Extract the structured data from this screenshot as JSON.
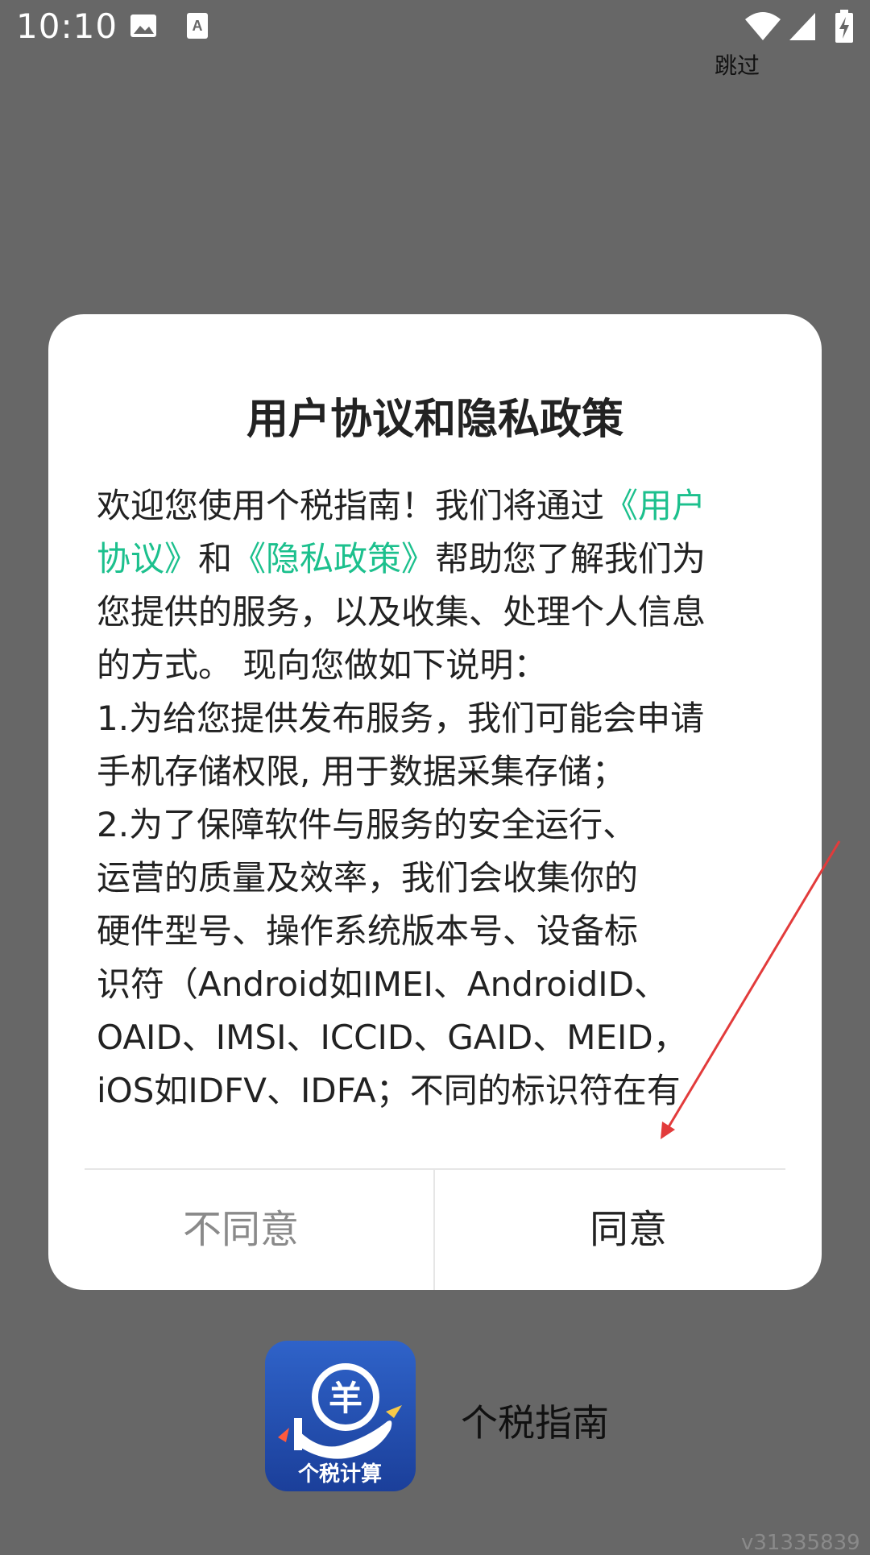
{
  "status_bar": {
    "time": "10:10",
    "icons": [
      "image-icon",
      "text-recognition-icon",
      "wifi-icon",
      "signal-icon",
      "battery-charging-icon"
    ]
  },
  "skip_label": "跳过",
  "dialog": {
    "title": "用户协议和隐私政策",
    "content_lines": [
      [
        {
          "t": "欢迎您使用个税指南！我们将通过"
        },
        {
          "t": "《用户",
          "link": true
        }
      ],
      [
        {
          "t": "协议》",
          "link": true
        },
        {
          "t": "和"
        },
        {
          "t": "《隐私政策》",
          "link": true
        },
        {
          "t": "帮助您了解我们为"
        }
      ],
      [
        {
          "t": "您提供的服务，以及收集、处理个人信息"
        }
      ],
      [
        {
          "t": "的方式。 现向您做如下说明："
        }
      ],
      [
        {
          "t": "1.为给您提供发布服务，我们可能会申请"
        }
      ],
      [
        {
          "t": "手机存储权限, 用于数据采集存储；"
        }
      ],
      [
        {
          "t": "2.为了保障软件与服务的安全运行、"
        }
      ],
      [
        {
          "t": "运营的质量及效率，我们会收集你的"
        }
      ],
      [
        {
          "t": "硬件型号、操作系统版本号、设备标"
        }
      ],
      [
        {
          "t": "识符（Android如IMEI、AndroidID、"
        }
      ],
      [
        {
          "t": "OAID、IMSI、ICCID、GAID、MEID，"
        }
      ],
      [
        {
          "t": "iOS如IDFV、IDFA；不同的标识符在有"
        }
      ]
    ],
    "disagree_label": "不同意",
    "agree_label": "同意",
    "link_color": "#1cc08d"
  },
  "app": {
    "name": "个税指南",
    "icon_text": "个税计算",
    "icon_symbol": "羊"
  },
  "watermark": "v31335839",
  "annotation_color": "#e23b3b"
}
